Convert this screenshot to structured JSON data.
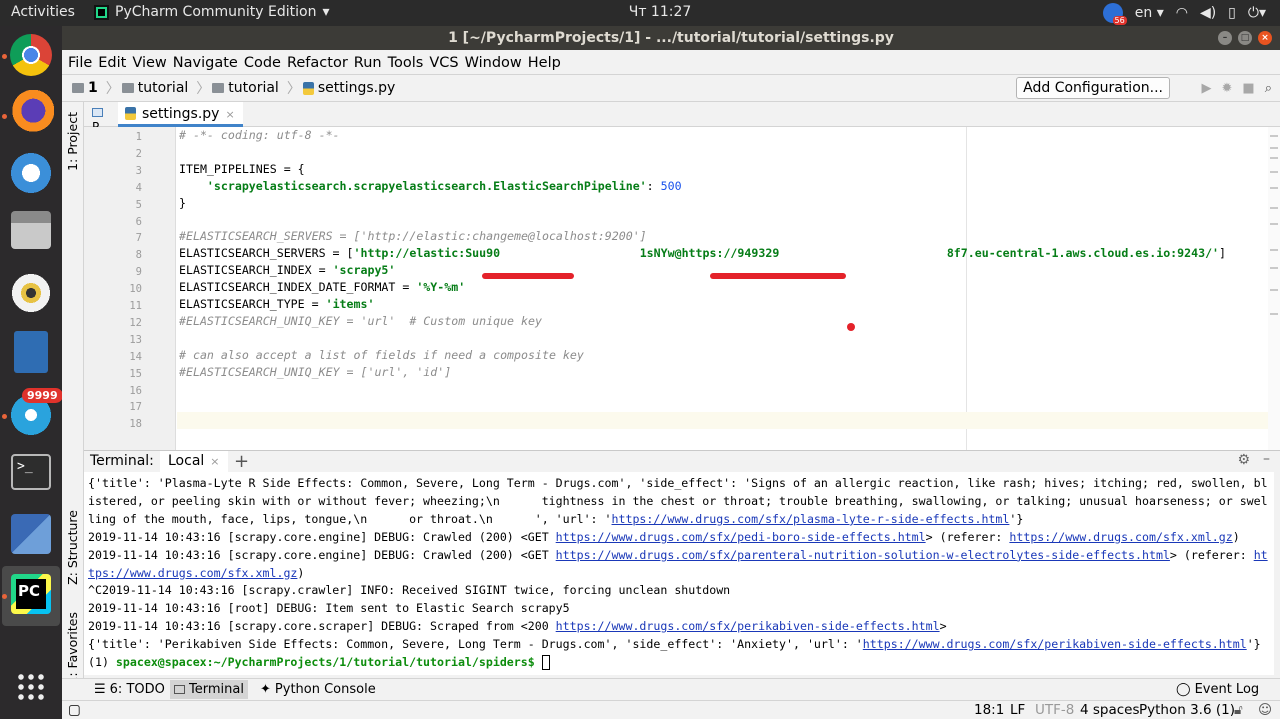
{
  "topbar": {
    "activities": "Activities",
    "app_name": "PyCharm Community Edition",
    "clock": "Чт 11:27",
    "lang": "en",
    "app_chevron": "▾",
    "lang_chevron": "▾",
    "tray_badge_count": "56",
    "tray_icons": [
      "wifi-icon",
      "volume-icon",
      "battery-icon",
      "power-icon"
    ]
  },
  "dock": {
    "apps": [
      "chrome",
      "firefox",
      "thunderbird",
      "files",
      "rhythmbox",
      "libreoffice-writer",
      "telegram",
      "terminal",
      "network",
      "pycharm",
      "show-applications"
    ],
    "telegram_badge": "9999",
    "terminal_glyph": ">_",
    "pycharm_glyph": "PC"
  },
  "window": {
    "title": "1 [~/PycharmProjects/1] - .../tutorial/tutorial/settings.py",
    "menu": [
      "File",
      "Edit",
      "View",
      "Navigate",
      "Code",
      "Refactor",
      "Run",
      "Tools",
      "VCS",
      "Window",
      "Help"
    ],
    "breadcrumbs": [
      "1",
      "tutorial",
      "tutorial",
      "settings.py"
    ],
    "add_configuration": "Add Configuration...",
    "left_tabs": [
      "1: Project",
      "Z: Structure",
      "2: Favorites"
    ],
    "project_tab_short": "P",
    "editor_tab": "settings.py",
    "tab_close_glyph": "×",
    "add_glyph": "+"
  },
  "editor": {
    "line_numbers": [
      "1",
      "2",
      "3",
      "4",
      "5",
      "6",
      "7",
      "8",
      "9",
      "10",
      "11",
      "12",
      "13",
      "14",
      "15",
      "16",
      "17",
      "18"
    ],
    "lines": [
      {
        "parts": [
          {
            "t": "# -*- coding: utf-8 -*-",
            "c": "cmt"
          }
        ]
      },
      {
        "parts": []
      },
      {
        "parts": [
          {
            "t": "ITEM_PIPELINES = {",
            "c": ""
          }
        ]
      },
      {
        "parts": [
          {
            "t": "    ",
            "c": ""
          },
          {
            "t": "'scrapyelasticsearch.scrapyelasticsearch.ElasticSearchPipeline'",
            "c": "str"
          },
          {
            "t": ": ",
            "c": ""
          },
          {
            "t": "500",
            "c": "num"
          }
        ]
      },
      {
        "parts": [
          {
            "t": "}",
            "c": ""
          }
        ]
      },
      {
        "parts": []
      },
      {
        "parts": [
          {
            "t": "#ELASTICSEARCH_SERVERS = ['http://elastic:changeme@localhost:9200']",
            "c": "cmt"
          }
        ]
      },
      {
        "parts": [
          {
            "t": "ELASTICSEARCH_SERVERS = [",
            "c": ""
          },
          {
            "t": "'http://elastic:Suu90                    1sNYw@https://949329                        8f7.eu-central-1.aws.cloud.es.io:9243/'",
            "c": "str"
          },
          {
            "t": "]",
            "c": ""
          }
        ]
      },
      {
        "parts": [
          {
            "t": "ELASTICSEARCH_INDEX = ",
            "c": ""
          },
          {
            "t": "'scrapy5'",
            "c": "str"
          }
        ]
      },
      {
        "parts": [
          {
            "t": "ELASTICSEARCH_INDEX_DATE_FORMAT = ",
            "c": ""
          },
          {
            "t": "'%Y-%m'",
            "c": "str"
          }
        ]
      },
      {
        "parts": [
          {
            "t": "ELASTICSEARCH_TYPE = ",
            "c": ""
          },
          {
            "t": "'items'",
            "c": "str"
          }
        ]
      },
      {
        "parts": [
          {
            "t": "#ELASTICSEARCH_UNIQ_KEY = 'url'  # Custom unique key",
            "c": "cmt"
          }
        ]
      },
      {
        "parts": []
      },
      {
        "parts": [
          {
            "t": "# can also accept a list of fields if need a composite key",
            "c": "cmt"
          }
        ]
      },
      {
        "parts": [
          {
            "t": "#ELASTICSEARCH_UNIQ_KEY = ['url', 'id']",
            "c": "cmt"
          }
        ]
      },
      {
        "parts": []
      },
      {
        "parts": []
      },
      {
        "parts": []
      }
    ]
  },
  "terminal": {
    "label": "Terminal:",
    "tab": "Local",
    "lines": [
      [
        {
          "t": "{'title': 'Plasma-Lyte R Side Effects: Common, Severe, Long Term - Drugs.com', 'side_effect': 'Signs of an allergic reaction, like rash; hives; itching; red, swollen, blistered, or peeling skin with or without fever; wheezing;\\n      tightness in the chest or throat; trouble breathing, swallowing, or talking; unusual hoarseness; or swelling of the mouth, face, lips, tongue,\\n      or throat.\\n      ', 'url': '"
        },
        {
          "t": "https://www.drugs.com/sfx/plasma-lyte-r-side-effects.html",
          "link": true
        },
        {
          "t": "'}"
        }
      ],
      [
        {
          "t": "2019-11-14 10:43:16 [scrapy.core.engine] DEBUG: Crawled (200) <GET "
        },
        {
          "t": "https://www.drugs.com/sfx/pedi-boro-side-effects.html",
          "link": true
        },
        {
          "t": "> (referer: "
        },
        {
          "t": "https://www.drugs.com/sfx.xml.gz",
          "link": true
        },
        {
          "t": ")"
        }
      ],
      [
        {
          "t": "2019-11-14 10:43:16 [scrapy.core.engine] DEBUG: Crawled (200) <GET "
        },
        {
          "t": "https://www.drugs.com/sfx/parenteral-nutrition-solution-w-electrolytes-side-effects.html",
          "link": true
        },
        {
          "t": "> (referer: "
        },
        {
          "t": "https://www.drugs.com/sfx.xml.gz",
          "link": true
        },
        {
          "t": ")"
        }
      ],
      [
        {
          "t": "^C2019-11-14 10:43:16 [scrapy.crawler] INFO: Received SIGINT twice, forcing unclean shutdown"
        }
      ],
      [
        {
          "t": "2019-11-14 10:43:16 [root] DEBUG: Item sent to Elastic Search scrapy5"
        }
      ],
      [
        {
          "t": "2019-11-14 10:43:16 [scrapy.core.scraper] DEBUG: Scraped from <200 "
        },
        {
          "t": "https://www.drugs.com/sfx/perikabiven-side-effects.html",
          "link": true
        },
        {
          "t": ">"
        }
      ],
      [
        {
          "t": "{'title': 'Perikabiven Side Effects: Common, Severe, Long Term - Drugs.com', 'side_effect': 'Anxiety', 'url': '"
        },
        {
          "t": "https://www.drugs.com/sfx/perikabiven-side-effects.html",
          "link": true
        },
        {
          "t": "'}"
        }
      ]
    ],
    "prompt_prefix": "(1) ",
    "prompt": "spacex@spacex:~/PycharmProjects/1/tutorial/tutorial/spiders$"
  },
  "toolwindows": {
    "todo": "6: TODO",
    "terminal": "Terminal",
    "python_console": "Python Console",
    "event_log": "Event Log"
  },
  "status": {
    "position": "18:1",
    "line_sep": "LF",
    "encoding": "UTF-8",
    "indent": "4 spaces",
    "interpreter": "Python 3.6 (1)"
  }
}
